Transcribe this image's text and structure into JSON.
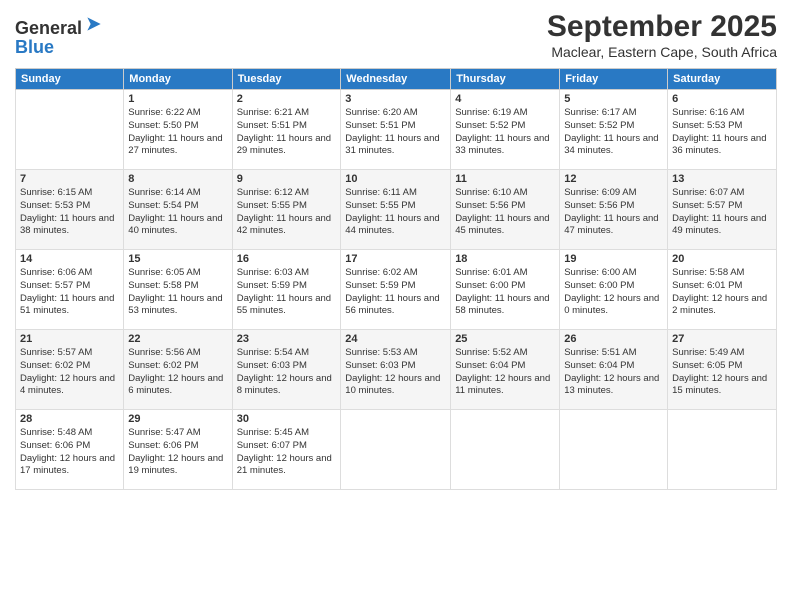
{
  "app": {
    "name": "GeneralBlue",
    "logo_text_line1": "General",
    "logo_text_line2": "Blue"
  },
  "header": {
    "month_title": "September 2025",
    "location": "Maclear, Eastern Cape, South Africa"
  },
  "days_of_week": [
    "Sunday",
    "Monday",
    "Tuesday",
    "Wednesday",
    "Thursday",
    "Friday",
    "Saturday"
  ],
  "weeks": [
    [
      {
        "date": "",
        "sunrise": "",
        "sunset": "",
        "daylight": ""
      },
      {
        "date": "1",
        "sunrise": "Sunrise: 6:22 AM",
        "sunset": "Sunset: 5:50 PM",
        "daylight": "Daylight: 11 hours and 27 minutes."
      },
      {
        "date": "2",
        "sunrise": "Sunrise: 6:21 AM",
        "sunset": "Sunset: 5:51 PM",
        "daylight": "Daylight: 11 hours and 29 minutes."
      },
      {
        "date": "3",
        "sunrise": "Sunrise: 6:20 AM",
        "sunset": "Sunset: 5:51 PM",
        "daylight": "Daylight: 11 hours and 31 minutes."
      },
      {
        "date": "4",
        "sunrise": "Sunrise: 6:19 AM",
        "sunset": "Sunset: 5:52 PM",
        "daylight": "Daylight: 11 hours and 33 minutes."
      },
      {
        "date": "5",
        "sunrise": "Sunrise: 6:17 AM",
        "sunset": "Sunset: 5:52 PM",
        "daylight": "Daylight: 11 hours and 34 minutes."
      },
      {
        "date": "6",
        "sunrise": "Sunrise: 6:16 AM",
        "sunset": "Sunset: 5:53 PM",
        "daylight": "Daylight: 11 hours and 36 minutes."
      }
    ],
    [
      {
        "date": "7",
        "sunrise": "Sunrise: 6:15 AM",
        "sunset": "Sunset: 5:53 PM",
        "daylight": "Daylight: 11 hours and 38 minutes."
      },
      {
        "date": "8",
        "sunrise": "Sunrise: 6:14 AM",
        "sunset": "Sunset: 5:54 PM",
        "daylight": "Daylight: 11 hours and 40 minutes."
      },
      {
        "date": "9",
        "sunrise": "Sunrise: 6:12 AM",
        "sunset": "Sunset: 5:55 PM",
        "daylight": "Daylight: 11 hours and 42 minutes."
      },
      {
        "date": "10",
        "sunrise": "Sunrise: 6:11 AM",
        "sunset": "Sunset: 5:55 PM",
        "daylight": "Daylight: 11 hours and 44 minutes."
      },
      {
        "date": "11",
        "sunrise": "Sunrise: 6:10 AM",
        "sunset": "Sunset: 5:56 PM",
        "daylight": "Daylight: 11 hours and 45 minutes."
      },
      {
        "date": "12",
        "sunrise": "Sunrise: 6:09 AM",
        "sunset": "Sunset: 5:56 PM",
        "daylight": "Daylight: 11 hours and 47 minutes."
      },
      {
        "date": "13",
        "sunrise": "Sunrise: 6:07 AM",
        "sunset": "Sunset: 5:57 PM",
        "daylight": "Daylight: 11 hours and 49 minutes."
      }
    ],
    [
      {
        "date": "14",
        "sunrise": "Sunrise: 6:06 AM",
        "sunset": "Sunset: 5:57 PM",
        "daylight": "Daylight: 11 hours and 51 minutes."
      },
      {
        "date": "15",
        "sunrise": "Sunrise: 6:05 AM",
        "sunset": "Sunset: 5:58 PM",
        "daylight": "Daylight: 11 hours and 53 minutes."
      },
      {
        "date": "16",
        "sunrise": "Sunrise: 6:03 AM",
        "sunset": "Sunset: 5:59 PM",
        "daylight": "Daylight: 11 hours and 55 minutes."
      },
      {
        "date": "17",
        "sunrise": "Sunrise: 6:02 AM",
        "sunset": "Sunset: 5:59 PM",
        "daylight": "Daylight: 11 hours and 56 minutes."
      },
      {
        "date": "18",
        "sunrise": "Sunrise: 6:01 AM",
        "sunset": "Sunset: 6:00 PM",
        "daylight": "Daylight: 11 hours and 58 minutes."
      },
      {
        "date": "19",
        "sunrise": "Sunrise: 6:00 AM",
        "sunset": "Sunset: 6:00 PM",
        "daylight": "Daylight: 12 hours and 0 minutes."
      },
      {
        "date": "20",
        "sunrise": "Sunrise: 5:58 AM",
        "sunset": "Sunset: 6:01 PM",
        "daylight": "Daylight: 12 hours and 2 minutes."
      }
    ],
    [
      {
        "date": "21",
        "sunrise": "Sunrise: 5:57 AM",
        "sunset": "Sunset: 6:02 PM",
        "daylight": "Daylight: 12 hours and 4 minutes."
      },
      {
        "date": "22",
        "sunrise": "Sunrise: 5:56 AM",
        "sunset": "Sunset: 6:02 PM",
        "daylight": "Daylight: 12 hours and 6 minutes."
      },
      {
        "date": "23",
        "sunrise": "Sunrise: 5:54 AM",
        "sunset": "Sunset: 6:03 PM",
        "daylight": "Daylight: 12 hours and 8 minutes."
      },
      {
        "date": "24",
        "sunrise": "Sunrise: 5:53 AM",
        "sunset": "Sunset: 6:03 PM",
        "daylight": "Daylight: 12 hours and 10 minutes."
      },
      {
        "date": "25",
        "sunrise": "Sunrise: 5:52 AM",
        "sunset": "Sunset: 6:04 PM",
        "daylight": "Daylight: 12 hours and 11 minutes."
      },
      {
        "date": "26",
        "sunrise": "Sunrise: 5:51 AM",
        "sunset": "Sunset: 6:04 PM",
        "daylight": "Daylight: 12 hours and 13 minutes."
      },
      {
        "date": "27",
        "sunrise": "Sunrise: 5:49 AM",
        "sunset": "Sunset: 6:05 PM",
        "daylight": "Daylight: 12 hours and 15 minutes."
      }
    ],
    [
      {
        "date": "28",
        "sunrise": "Sunrise: 5:48 AM",
        "sunset": "Sunset: 6:06 PM",
        "daylight": "Daylight: 12 hours and 17 minutes."
      },
      {
        "date": "29",
        "sunrise": "Sunrise: 5:47 AM",
        "sunset": "Sunset: 6:06 PM",
        "daylight": "Daylight: 12 hours and 19 minutes."
      },
      {
        "date": "30",
        "sunrise": "Sunrise: 5:45 AM",
        "sunset": "Sunset: 6:07 PM",
        "daylight": "Daylight: 12 hours and 21 minutes."
      },
      {
        "date": "",
        "sunrise": "",
        "sunset": "",
        "daylight": ""
      },
      {
        "date": "",
        "sunrise": "",
        "sunset": "",
        "daylight": ""
      },
      {
        "date": "",
        "sunrise": "",
        "sunset": "",
        "daylight": ""
      },
      {
        "date": "",
        "sunrise": "",
        "sunset": "",
        "daylight": ""
      }
    ]
  ]
}
